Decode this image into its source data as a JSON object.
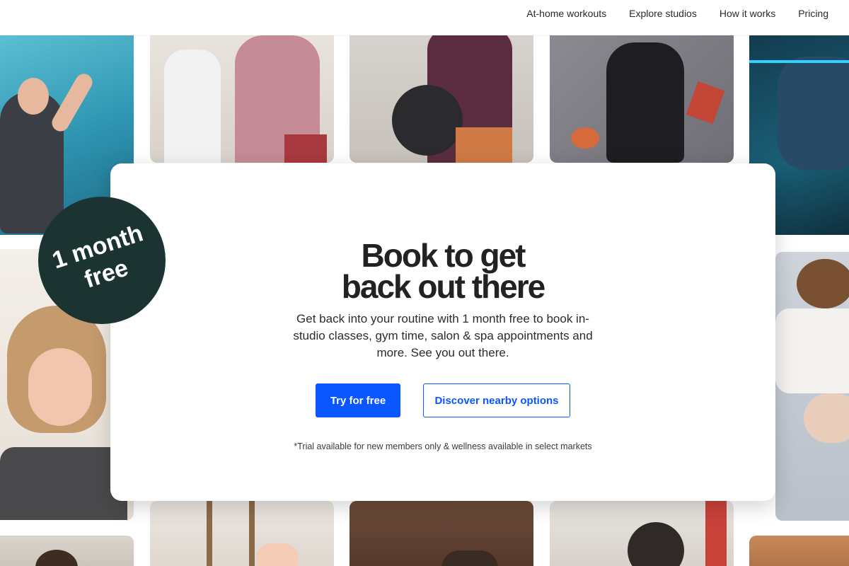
{
  "nav": {
    "links": [
      "At-home workouts",
      "Explore studios",
      "How it works",
      "Pricing"
    ]
  },
  "badge": {
    "line1": "1 month",
    "line2": "free"
  },
  "hero": {
    "title_line1": "Book to get",
    "title_line2": "back out there",
    "subtitle": "Get back into your routine with 1 month free to book in-studio classes, gym time, salon & spa appointments and more. See you out there.",
    "primary_cta": "Try for free",
    "secondary_cta": "Discover nearby options",
    "disclaimer": "*Trial available for new members only & wellness available in select markets"
  },
  "colors": {
    "primary": "#0a57ff",
    "badge_bg": "#1b3432",
    "text": "#222222"
  }
}
